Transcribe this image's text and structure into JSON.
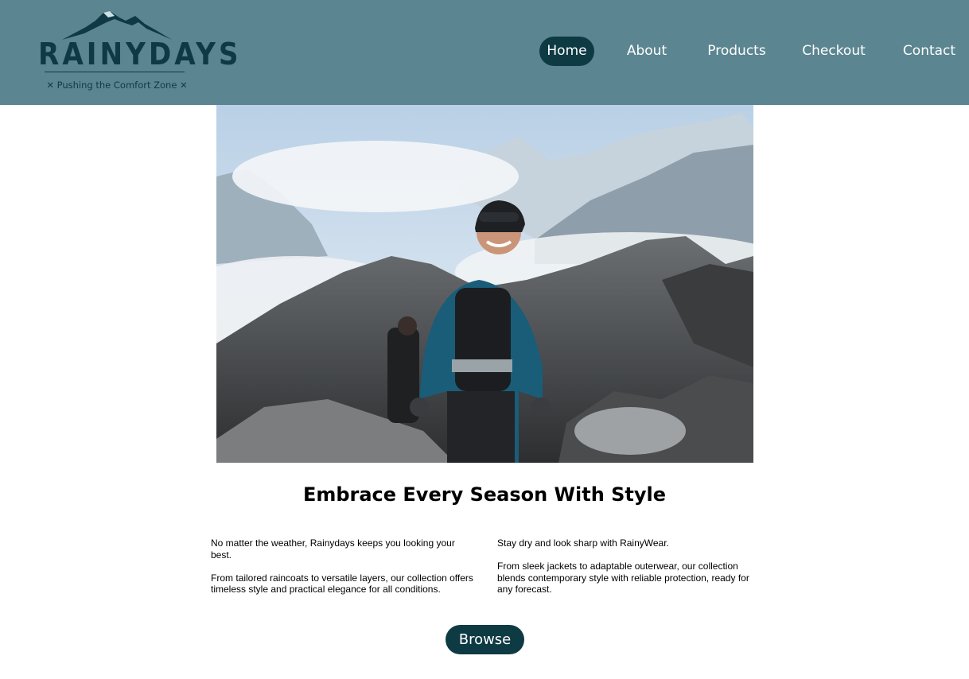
{
  "brand": {
    "name": "RAINYDAYS",
    "tagline": "✕ Pushing the Comfort Zone ✕",
    "logo_icon": "mountain-icon",
    "color": "#0f3a45"
  },
  "header": {
    "background": "#5b8590"
  },
  "nav": {
    "items": [
      {
        "label": "Home",
        "active": true
      },
      {
        "label": "About",
        "active": false
      },
      {
        "label": "Products",
        "active": false
      },
      {
        "label": "Checkout",
        "active": false
      },
      {
        "label": "Contact",
        "active": false
      }
    ],
    "active_color": "#0e3a44"
  },
  "hero": {
    "image": "hiker-in-snowy-mountains"
  },
  "main": {
    "headline": "Embrace Every Season With Style",
    "left_column": {
      "p1": "No matter the weather, Rainydays keeps you looking your best.",
      "p2": "From tailored raincoats to versatile layers, our collection offers timeless style and practical elegance for all conditions."
    },
    "right_column": {
      "p1": "Stay dry and look sharp with RainyWear.",
      "p2": "From sleek jackets to adaptable outerwear, our collection blends contemporary style with reliable protection, ready for any forecast."
    },
    "browse_label": "Browse"
  }
}
